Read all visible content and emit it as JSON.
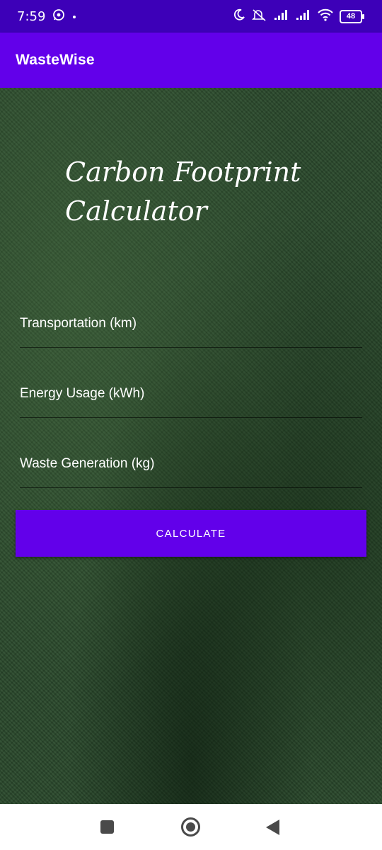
{
  "status_bar": {
    "time": "7:59",
    "battery": "48",
    "left_icons": [
      "whatsapp-icon",
      "dot-icon"
    ],
    "right_icons": [
      "moon-icon",
      "mute-icon",
      "signal-icon",
      "signal-icon",
      "wifi-icon",
      "battery-icon"
    ]
  },
  "app_bar": {
    "title": "WasteWise"
  },
  "main": {
    "heading": "Carbon Footprint\nCalculator",
    "fields": [
      {
        "placeholder": "Transportation (km)",
        "value": ""
      },
      {
        "placeholder": "Energy Usage (kWh)",
        "value": ""
      },
      {
        "placeholder": "Waste Generation (kg)",
        "value": ""
      }
    ],
    "button_label": "CALCULATE"
  },
  "nav_bar": {
    "icons": [
      "recents-square-icon",
      "home-circle-icon",
      "back-triangle-icon"
    ]
  },
  "colors": {
    "primary": "#6200ea",
    "status_bar": "#3d00b8",
    "background": "#2b4a2d"
  }
}
